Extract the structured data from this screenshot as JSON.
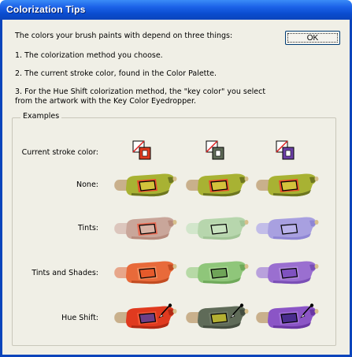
{
  "window": {
    "title": "Colorization Tips"
  },
  "buttons": {
    "ok": "OK"
  },
  "intro": "The colors your brush paints with depend on three things:",
  "tips": [
    "1. The colorization method you choose.",
    "2. The current stroke color, found in the Color Palette.",
    "3. For the Hue Shift colorization method, the \"key color\" you select",
    "from the artwork with the Key Color Eyedropper."
  ],
  "examples": {
    "label": "Examples",
    "rows": [
      "Current stroke color:",
      "None:",
      "Tints:",
      "Tints and Shades:",
      "Hue Shift:"
    ],
    "stroke_colors": [
      "#e03a1f",
      "#5f6b58",
      "#6b3fa6"
    ],
    "brushes": {
      "none": [
        {
          "body": "#a8b233",
          "dark": "#6d7620",
          "window": "#d3c23b",
          "frame": "#e94e2a",
          "tail": "#c9b08c"
        },
        {
          "body": "#a8b233",
          "dark": "#6d7620",
          "window": "#d3c23b",
          "frame": "#e94e2a",
          "tail": "#c9b08c"
        },
        {
          "body": "#a8b233",
          "dark": "#6d7620",
          "window": "#d3c23b",
          "frame": "#e94e2a",
          "tail": "#c9b08c"
        }
      ],
      "tints": [
        {
          "body": "#c9a69a",
          "dark": "#b78b7d",
          "window": "#d7b3a6",
          "frame": "#e96a52",
          "tail": "#dcc6bd"
        },
        {
          "body": "#b7d6ad",
          "dark": "#a2c597",
          "window": "#c8e2bf",
          "frame": "#bfdcb4",
          "tail": "#d2e6cb"
        },
        {
          "body": "#a8a0e0",
          "dark": "#8f86d4",
          "window": "#b9b2ea",
          "frame": "#a79ee0",
          "tail": "#c2bde8"
        }
      ],
      "tints_and_shades": [
        {
          "body": "#e86a3a",
          "dark": "#c24c22",
          "window": "#e55a2b",
          "frame": "#f28a5a",
          "tail": "#e7a68a"
        },
        {
          "body": "#8fc67a",
          "dark": "#6fa95a",
          "window": "#6fa458",
          "frame": "#a7d690",
          "tail": "#b7d9a6"
        },
        {
          "body": "#9a6fd0",
          "dark": "#7a4fb6",
          "window": "#7f52bf",
          "frame": "#b08adc",
          "tail": "#b9a1dc"
        }
      ],
      "hue_shift": [
        {
          "body": "#e03a1f",
          "dark": "#b02a14",
          "window": "#6d3f86",
          "frame": "#f05535",
          "tail": "#c9b08c"
        },
        {
          "body": "#5f6b58",
          "dark": "#454e40",
          "window": "#b4b032",
          "frame": "#717c68",
          "tail": "#c9b08c"
        },
        {
          "body": "#8b55c6",
          "dark": "#6a37a3",
          "window": "#4a2d8e",
          "frame": "#a06fd8",
          "tail": "#c9b08c"
        }
      ]
    }
  }
}
